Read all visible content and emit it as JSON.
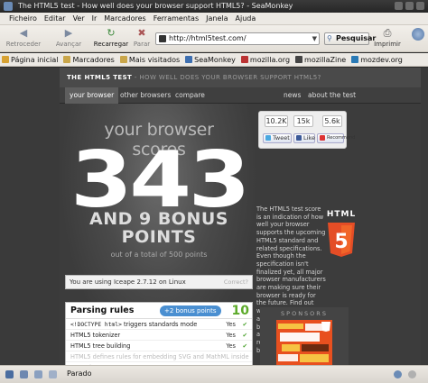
{
  "window": {
    "title": "The HTML5 test - How well does your browser support HTML5? - SeaMonkey"
  },
  "menu": [
    "Ficheiro",
    "Editar",
    "Ver",
    "Ir",
    "Marcadores",
    "Ferramentas",
    "Janela",
    "Ajuda"
  ],
  "nav": {
    "back": "Retroceder",
    "forward": "Avançar",
    "reload": "Recarregar",
    "stop": "Parar",
    "url": "http://html5test.com/",
    "search": "Pesquisar",
    "print": "Imprimir"
  },
  "bookmarks": [
    "Página inicial",
    "Marcadores",
    "Mais visitados",
    "SeaMonkey",
    "mozilla.org",
    "mozillaZine",
    "mozdev.org"
  ],
  "site": {
    "brand": "THE HTML5 TEST",
    "tagline": " - HOW WELL DOES YOUR BROWSER SUPPORT HTML5?",
    "tabs": [
      "your browser",
      "other browsers",
      "compare",
      "news",
      "about the test"
    ]
  },
  "score": {
    "heading": "your browser scores",
    "value": "343",
    "bonus_line1": "AND 9 BONUS",
    "bonus_line2": "POINTS",
    "out_of": "out of a total of 500 points"
  },
  "social": {
    "counts": [
      "10.2K",
      "15k",
      "5.6k"
    ],
    "buttons": [
      "Tweet",
      "Like",
      "Recommend"
    ]
  },
  "about": {
    "text": "The HTML5 test score is an indication of how well your browser supports the upcoming HTML5 standard and related specifications. Even though the specification isn't finalized yet, all major browser manufacturers are making sure their browser is ready for the future. Find out which parts of HTML5 are already supported by your browser today and compare the results with other browsers.",
    "logo_label": "HTML"
  },
  "sponsors": {
    "label": "SPONSORS"
  },
  "useragent": {
    "text": "You are using Iceape 2.7.12 on Linux",
    "correct": "Correct?"
  },
  "results": {
    "title": "Parsing rules",
    "bonus": "+2 bonus points",
    "points": "10",
    "rows": [
      {
        "pre": "",
        "code": "<!DOCTYPE html>",
        "post": " triggers standards mode",
        "status": "Yes"
      },
      {
        "pre": "HTML5 tokenizer",
        "code": "",
        "post": "",
        "status": "Yes"
      },
      {
        "pre": "HTML5 tree building",
        "code": "",
        "post": "",
        "status": "Yes"
      },
      {
        "pre": "HTML5 defines rules for embedding SVG and MathML inside a regular",
        "code": "",
        "post": "",
        "status": ""
      }
    ]
  },
  "status": {
    "text": "Parado"
  },
  "colors": {
    "accent": "#4a8fd1",
    "pass": "#4ca22e",
    "html5_orange": "#e44d26"
  }
}
